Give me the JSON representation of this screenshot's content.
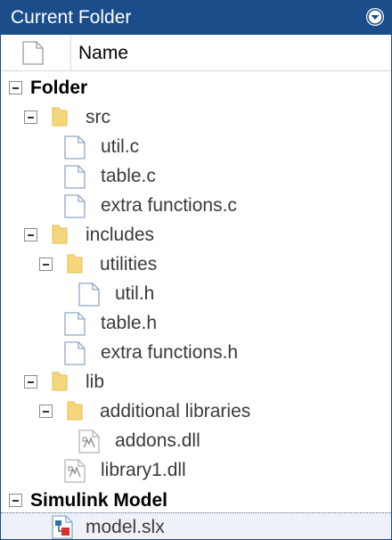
{
  "window": {
    "title": "Current Folder"
  },
  "header": {
    "name_column": "Name"
  },
  "groups": [
    {
      "label": "Folder"
    },
    {
      "label": "Simulink Model"
    }
  ],
  "tree": {
    "src": "src",
    "util_c": "util.c",
    "table_c": "table.c",
    "extra_functions_c": "extra functions.c",
    "includes": "includes",
    "utilities": "utilities",
    "util_h": "util.h",
    "table_h": "table.h",
    "extra_functions_h": "extra functions.h",
    "lib": "lib",
    "additional_libraries": "additional libraries",
    "addons_dll": "addons.dll",
    "library1_dll": "library1.dll",
    "model_slx": "model.slx"
  },
  "icons": {
    "folder": "folder-icon",
    "file": "file-icon",
    "dll": "dll-icon",
    "model": "simulink-model-icon",
    "menu": "panel-menu-icon"
  },
  "colors": {
    "titlebar": "#1a4d8a",
    "folder": "#f6d67a",
    "text": "#3a3a3a"
  }
}
